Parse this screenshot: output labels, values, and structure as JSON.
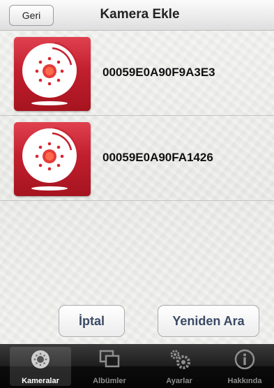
{
  "navbar": {
    "back_label": "Geri",
    "title": "Kamera Ekle"
  },
  "cameras": [
    {
      "id": "00059E0A90F9A3E3",
      "icon": "camera-icon"
    },
    {
      "id": "00059E0A90FA1426",
      "icon": "camera-icon"
    }
  ],
  "actions": {
    "cancel_label": "İptal",
    "rescan_label": "Yeniden Ara"
  },
  "tabbar": {
    "active": "Kameralar",
    "tabs": [
      {
        "label": "Kameralar",
        "icon": "camera-icon"
      },
      {
        "label": "Albümler",
        "icon": "albums-icon"
      },
      {
        "label": "Ayarlar",
        "icon": "gears-icon"
      },
      {
        "label": "Hakkında",
        "icon": "info-icon"
      }
    ]
  },
  "colors": {
    "brand_red": "#c21f2e",
    "button_text": "#3b4a66",
    "tabbar_bg": "#0c0c0c"
  }
}
